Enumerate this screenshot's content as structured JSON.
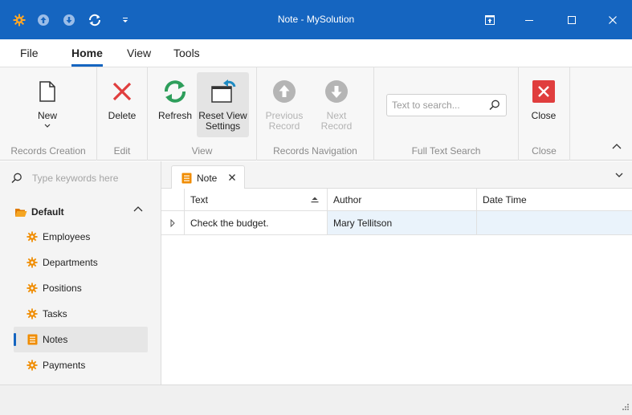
{
  "window": {
    "title": "Note - MySolution"
  },
  "titlebar": {
    "app_icon": "gear-icon",
    "quick_access": [
      "arrow-up-circle-icon",
      "arrow-down-circle-icon",
      "refresh-icon",
      "customize-chevron-icon"
    ],
    "controls": [
      "restore-tab-icon",
      "minimize-icon",
      "maximize-icon",
      "close-icon"
    ]
  },
  "menu": {
    "tabs": [
      {
        "label": "File"
      },
      {
        "label": "Home",
        "active": true
      },
      {
        "label": "View"
      },
      {
        "label": "Tools"
      }
    ]
  },
  "ribbon": {
    "groups": [
      {
        "label": "Records Creation",
        "buttons": [
          {
            "label": "New",
            "icon": "new-document-icon"
          }
        ]
      },
      {
        "label": "Edit",
        "buttons": [
          {
            "label": "Delete",
            "icon": "delete-x-icon"
          }
        ]
      },
      {
        "label": "View",
        "buttons": [
          {
            "label": "Refresh",
            "icon": "refresh-icon"
          },
          {
            "label": "Reset View Settings",
            "label_line1": "Reset View",
            "label_line2": "Settings",
            "icon": "reset-view-icon"
          }
        ]
      },
      {
        "label": "Records Navigation",
        "buttons": [
          {
            "label": "Previous Record",
            "label_line1": "Previous",
            "label_line2": "Record",
            "icon": "arrow-up-circle-icon",
            "disabled": true
          },
          {
            "label": "Next Record",
            "icon": "arrow-down-circle-icon",
            "disabled": true
          }
        ]
      },
      {
        "label": "Full Text Search",
        "search_placeholder": "Text to search..."
      },
      {
        "label": "Close",
        "buttons": [
          {
            "label": "Close",
            "icon": "close-red-icon"
          }
        ]
      }
    ]
  },
  "navigation": {
    "search_placeholder": "Type keywords here",
    "group_label": "Default",
    "items": [
      {
        "label": "Employees",
        "icon": "gear-icon"
      },
      {
        "label": "Departments",
        "icon": "gear-icon"
      },
      {
        "label": "Positions",
        "icon": "gear-icon"
      },
      {
        "label": "Tasks",
        "icon": "gear-icon"
      },
      {
        "label": "Notes",
        "icon": "note-icon",
        "selected": true
      },
      {
        "label": "Payments",
        "icon": "gear-icon"
      }
    ]
  },
  "document": {
    "tab_label": "Note",
    "grid": {
      "columns": [
        "Text",
        "Author",
        "Date Time"
      ],
      "rows": [
        {
          "text": "Check the budget.",
          "author": "Mary Tellitson",
          "date_time": ""
        }
      ]
    }
  },
  "colors": {
    "accent": "#1565c0",
    "gear": "#f08c00",
    "delete": "#e03e3e",
    "refresh": "#2e9e5b",
    "row_highlight": "#eaf3fb"
  }
}
